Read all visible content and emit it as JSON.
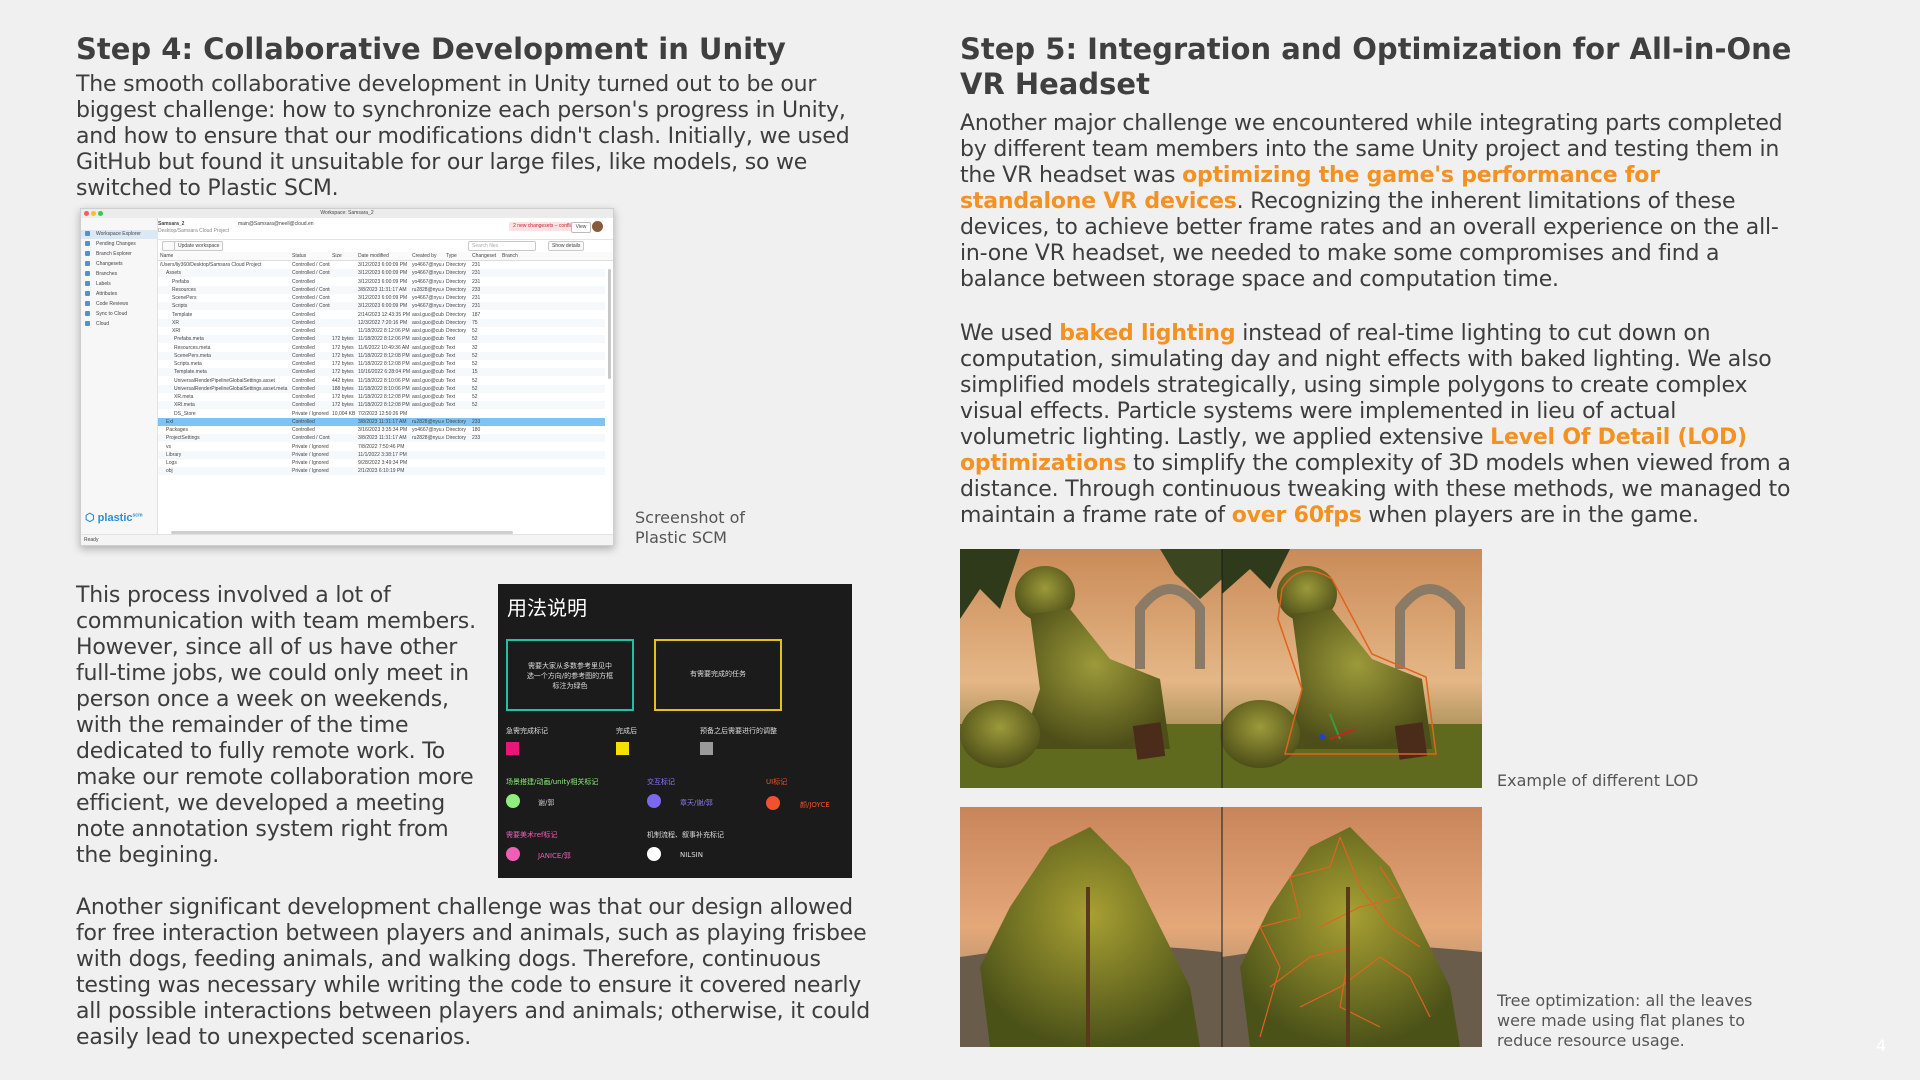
{
  "left": {
    "title": "Step 4: Collaborative Development in Unity",
    "p1": "The smooth collaborative development in Unity turned out to be our biggest challenge: how to synchronize each person's progress in Unity, and how to ensure that our modifications didn't clash. Initially, we used GitHub but found it unsuitable for our large files, like models, so we switched to Plastic SCM.",
    "scm_caption_1": "Screenshot of",
    "scm_caption_2": "Plastic SCM",
    "p2": "This process involved a lot of communication with team members. However, since all of us have other full-time jobs, we could only meet in person once a week on weekends, with the remainder of the time dedicated to fully remote work. To make our remote collaboration more efficient, we developed a meeting note annotation system right from the begining.",
    "p3": "Another significant development challenge was that our design allowed for free interaction between players and animals, such as playing frisbee with dogs, feeding animals, and walking dogs. Therefore, continuous testing was necessary while writing the code to ensure it covered nearly all possible interactions between players and animals; otherwise, it could easily lead to unexpected scenarios."
  },
  "scm": {
    "window_title": "Workspace: Samsara_2",
    "workspace_name": "Samsara_2",
    "workspace_sub": "Desktop/Samsara Cloud Project",
    "branch": "main@Samsara@neell@cloud.en",
    "conflict_text": "2 new changesets – conflicts",
    "view_label": "View",
    "update_label": "Update workspace",
    "search_placeholder": "Search files",
    "show_details": "Show details",
    "status": "Ready",
    "logo": "plastic",
    "sidebar": [
      "Workspace Explorer",
      "Pending Changes",
      "Branch Explorer",
      "Changesets",
      "Branches",
      "Labels",
      "Attributes",
      "Code Reviews",
      "Sync to Cloud",
      "Cloud"
    ],
    "columns": [
      "Name",
      "Status",
      "Size",
      "Date modified",
      "Created by",
      "Type",
      "Changeset",
      "Branch"
    ],
    "rows": [
      [
        "/Users/liy360/Desktop/Samsara Cloud Project",
        "Controlled / Contro",
        "",
        "3/12/2023 6:00:09 PM",
        "yo4667@nyu.edu",
        "Directory",
        "231"
      ],
      [
        "Assets",
        "Controlled / Contro",
        "",
        "3/12/2023 6:00:09 PM",
        "yo4667@nyu.edu",
        "Directory",
        "231"
      ],
      [
        "Prefabs",
        "Controlled",
        "",
        "3/12/2023 6:00:09 PM",
        "yo4667@nyu.edu",
        "Directory",
        "231"
      ],
      [
        "Resources",
        "Controlled / Contro",
        "",
        "3/8/2023 11:31:17 AM",
        "ru2828@nyu.edu",
        "Directory",
        "233"
      ],
      [
        "ScenePers",
        "Controlled / Contro",
        "",
        "3/12/2023 6:00:09 PM",
        "yo4667@nyu.edu",
        "Directory",
        "231"
      ],
      [
        "Scripts",
        "Controlled / Contro",
        "",
        "3/12/2023 6:00:09 PM",
        "yo4667@nyu.edu",
        "Directory",
        "231"
      ],
      [
        "Template",
        "Controlled",
        "",
        "2/14/2023 12:43:35 PM",
        "assl.guo@cubic",
        "Directory",
        "187"
      ],
      [
        "XR",
        "Controlled",
        "",
        "12/3/2022 7:20:16 PM",
        "assl.guo@cubic",
        "Directory",
        "75"
      ],
      [
        "XRI",
        "Controlled",
        "",
        "11/18/2022 8:12:06 PM",
        "assl.guo@cubic",
        "Directory",
        "52"
      ],
      [
        "Prefabs.meta",
        "Controlled",
        "172 bytes",
        "11/18/2022 8:12:06 PM",
        "assl.guo@cubic",
        "Text",
        "52"
      ],
      [
        "Resources.meta",
        "Controlled",
        "172 bytes",
        "11/6/2022 10:49:36 AM",
        "assl.guo@cubic",
        "Text",
        "32"
      ],
      [
        "ScenePers.meta",
        "Controlled",
        "172 bytes",
        "11/18/2022 8:12:08 PM",
        "assl.guo@cubic",
        "Text",
        "52"
      ],
      [
        "Scripts.meta",
        "Controlled",
        "172 bytes",
        "11/18/2022 8:12:08 PM",
        "assl.guo@cubic",
        "Text",
        "52"
      ],
      [
        "Template.meta",
        "Controlled",
        "172 bytes",
        "10/16/2022 6:28:04 PM",
        "assl.guo@cubic",
        "Text",
        "15"
      ],
      [
        "UniversalRenderPipelineGlobalSettings.asset",
        "Controlled",
        "442 bytes",
        "11/18/2022 8:10:06 PM",
        "assl.guo@cubic",
        "Text",
        "52"
      ],
      [
        "UniversalRenderPipelineGlobalSettings.asset.meta",
        "Controlled",
        "188 bytes",
        "11/18/2022 8:10:06 PM",
        "assl.guo@cubic",
        "Text",
        "52"
      ],
      [
        "XR.meta",
        "Controlled",
        "172 bytes",
        "11/18/2022 8:12:08 PM",
        "assl.guo@cubic",
        "Text",
        "52"
      ],
      [
        "XRI.meta",
        "Controlled",
        "172 bytes",
        "11/18/2022 8:12:08 PM",
        "assl.guo@cubic",
        "Text",
        "52"
      ],
      [
        "DS_Store",
        "Private / Ignored",
        "10,004 KB",
        "7/2/2023 12:50:26 PM",
        "",
        "",
        ""
      ],
      [
        "Ext",
        "Controlled",
        "",
        "3/8/2023 11:31:17 AM",
        "ru2828@nyu.edu",
        "Directory",
        "233"
      ],
      [
        "Packages",
        "Controlled",
        "",
        "3/16/2023 3:35:34 PM",
        "yo4667@nyu.edu",
        "Directory",
        "180"
      ],
      [
        "ProjectSettings",
        "Controlled / Contro",
        "",
        "3/8/2023 11:31:17 AM",
        "ru2828@nyu.edu",
        "Directory",
        "233"
      ],
      [
        "vs",
        "Private / Ignored",
        "",
        "7/8/2022 7:50:46 PM",
        "",
        "",
        ""
      ],
      [
        "Library",
        "Private / Ignored",
        "",
        "11/1/2022 3:38:17 PM",
        "",
        "",
        ""
      ],
      [
        "Logs",
        "Private / Ignored",
        "",
        "9/28/2022 3:49:34 PM",
        "",
        "",
        ""
      ],
      [
        "obj",
        "Private / Ignored",
        "",
        "2/1/2023 6:10:19 PM",
        "",
        "",
        ""
      ]
    ]
  },
  "notes": {
    "title": "用法说明",
    "box1": "需要大家从多数参考里见中选一个方向/的参考图的方框标注为绿色",
    "box2": "有需要完成的任务",
    "urgent": "急需完成标记",
    "done": "完成后",
    "later": "预备之后需要进行的调整",
    "scene": "场景搭建/动画/unity相关标记",
    "interaction": "交互标记",
    "ui": "UI标记",
    "scene_who": "谢/郭",
    "interaction_who": "章天/谢/郭",
    "ui_who": "颜/JOYCE",
    "art": "需要美术ref标记",
    "mech": "机制流程、叙事补充标记",
    "art_who": "JANICE/郭",
    "mech_who": "NILSIN",
    "colors": {
      "green": "#1fc3a1",
      "yellow": "#e2c11b",
      "pink": "#e8157b",
      "gold": "#f4e100",
      "gray": "#9a9a9a",
      "lime": "#8ef07a",
      "violet": "#7b68f0",
      "orange": "#f0522f",
      "rose": "#f05fb7",
      "white": "#ffffff"
    }
  },
  "right": {
    "title": "Step 5: Integration and Optimization for All-in-One VR Headset",
    "p1_a": "Another major challenge we encountered while integrating parts completed by different team members into the same Unity project and testing them in the VR headset was ",
    "p1_hl": "optimizing the game's performance for standalone VR devices",
    "p1_b": ". Recognizing the inherent limitations of these devices, to achieve better frame rates and an overall experience on the all-in-one VR headset, we needed to make some compromises and find a balance between storage space and computation time.",
    "p2_a": "We used ",
    "p2_hl1": "baked lighting",
    "p2_b": " instead of real-time lighting to cut down on computation, simulating day and night effects with baked lighting. We also simplified models strategically, using simple polygons to create complex visual effects. Particle systems were implemented in lieu of actual volumetric lighting. Lastly, we applied extensive ",
    "p2_hl2": "Level Of Detail (LOD) optimizations",
    "p2_c": " to simplify the complexity of 3D models when viewed from a distance. Through continuous tweaking with these methods, we managed to maintain a frame rate of ",
    "p2_hl3": "over 60fps",
    "p2_d": " when players are in the game.",
    "lod_caption": "Example of different LOD",
    "tree_caption": "Tree optimization: all the leaves were made using flat planes to reduce resource usage."
  },
  "page_number": "4",
  "accent_color": "#f39121"
}
